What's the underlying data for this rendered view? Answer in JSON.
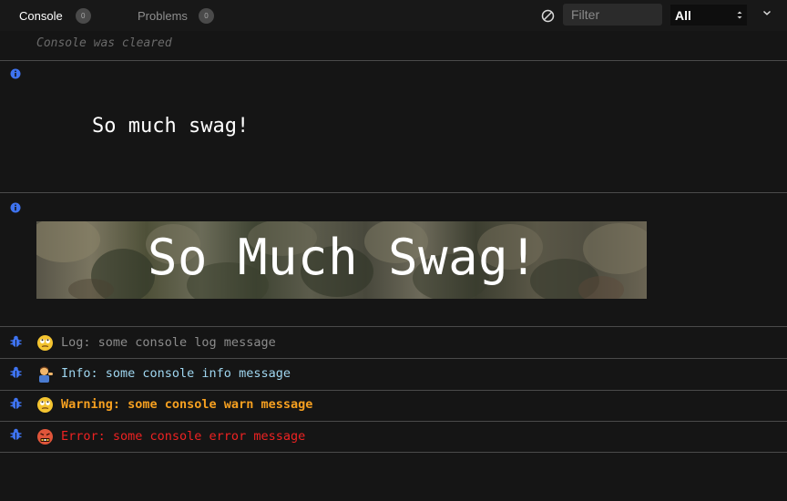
{
  "toolbar": {
    "tabs": [
      {
        "label": "Console",
        "count": "0"
      },
      {
        "label": "Problems",
        "count": "0"
      }
    ],
    "clear_icon": "clear-console-icon",
    "filter_placeholder": "Filter",
    "level_select": {
      "value": "All"
    },
    "chevron_icon": "chevron-down-icon"
  },
  "console": {
    "cleared_text": "Console was cleared",
    "entries": [
      {
        "type": "info",
        "icon": "info-icon",
        "text": "So much swag!"
      },
      {
        "type": "info",
        "icon": "info-icon",
        "text": "So Much Swag!"
      },
      {
        "type": "log",
        "icon": "bug-icon",
        "emoji": "face-with-rolling-eyes",
        "text": "Log: some console log message",
        "color": "#8c8c8c"
      },
      {
        "type": "info",
        "icon": "bug-icon",
        "emoji": "person-tipping-hand",
        "text": "Info: some console info message",
        "color": "#9fd6f0"
      },
      {
        "type": "warn",
        "icon": "bug-icon",
        "emoji": "face-with-rolling-eyes",
        "text": "Warning: some console warn message",
        "color": "#f6a020"
      },
      {
        "type": "error",
        "icon": "bug-icon",
        "emoji": "face-with-symbols-on-mouth",
        "text": "Error: some console error message",
        "color": "#ee2222"
      }
    ]
  },
  "colors": {
    "background": "#151515",
    "separator": "#4a4a4a",
    "icon_blue": "#3e73f0"
  }
}
